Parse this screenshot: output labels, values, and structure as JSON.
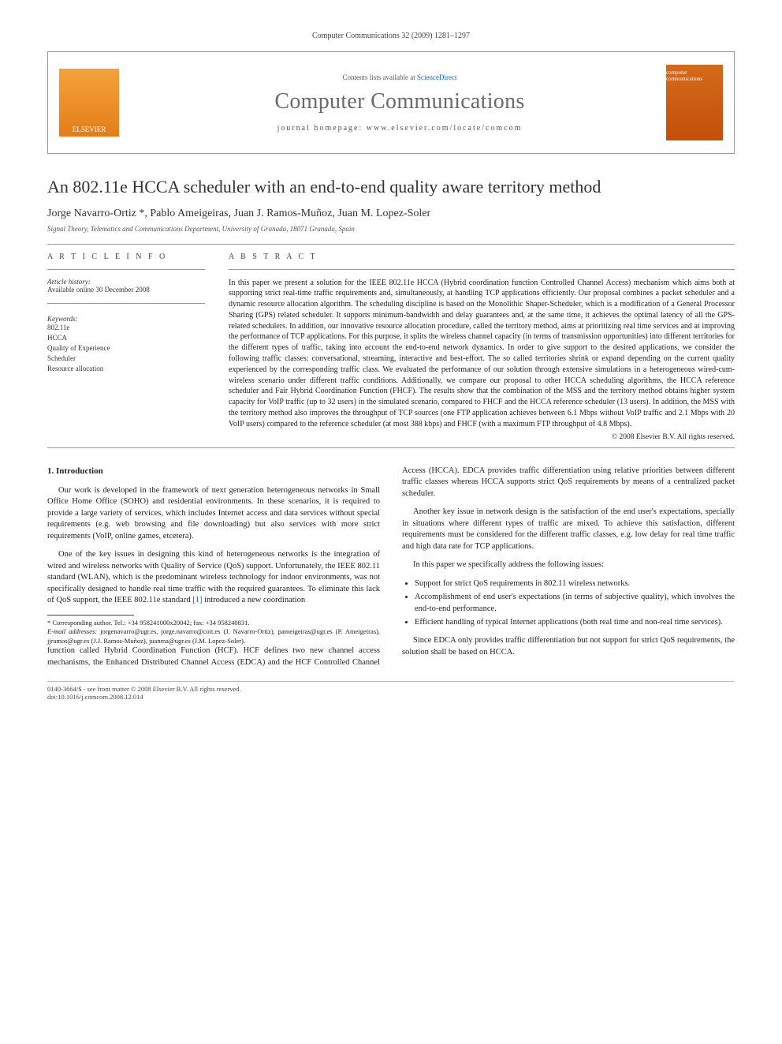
{
  "header_citation": "Computer Communications 32 (2009) 1281–1297",
  "journal_box": {
    "contents_prefix": "Contents lists available at ",
    "contents_link": "ScienceDirect",
    "journal_name": "Computer Communications",
    "homepage_label": "journal homepage: www.elsevier.com/locate/comcom",
    "elsevier_label": "ELSEVIER",
    "cover_label": "computer communications"
  },
  "title": "An 802.11e HCCA scheduler with an end-to-end quality aware territory method",
  "authors": "Jorge Navarro-Ortiz *, Pablo Ameigeiras, Juan J. Ramos-Muñoz, Juan M. Lopez-Soler",
  "affiliation": "Signal Theory, Telematics and Communications Department, University of Granada, 18071 Granada, Spain",
  "article_info": {
    "heading": "A R T I C L E   I N F O",
    "history_label": "Article history:",
    "history_line": "Available online 30 December 2008",
    "keywords_label": "Keywords:",
    "keywords": [
      "802.11e",
      "HCCA",
      "Quality of Experience",
      "Scheduler",
      "Resource allocation"
    ]
  },
  "abstract": {
    "heading": "A B S T R A C T",
    "text": "In this paper we present a solution for the IEEE 802.11e HCCA (Hybrid coordination function Controlled Channel Access) mechanism which aims both at supporting strict real-time traffic requirements and, simultaneously, at handling TCP applications efficiently. Our proposal combines a packet scheduler and a dynamic resource allocation algorithm. The scheduling discipline is based on the Monolithic Shaper-Scheduler, which is a modification of a General Processor Sharing (GPS) related scheduler. It supports minimum-bandwidth and delay guarantees and, at the same time, it achieves the optimal latency of all the GPS-related schedulers. In addition, our innovative resource allocation procedure, called the territory method, aims at prioritizing real time services and at improving the performance of TCP applications. For this purpose, it splits the wireless channel capacity (in terms of transmission opportunities) into different territories for the different types of traffic, taking into account the end-to-end network dynamics. In order to give support to the desired applications, we consider the following traffic classes: conversational, streaming, interactive and best-effort. The so called territories shrink or expand depending on the current quality experienced by the corresponding traffic class. We evaluated the performance of our solution through extensive simulations in a heterogeneous wired-cum-wireless scenario under different traffic conditions. Additionally, we compare our proposal to other HCCA scheduling algorithms, the HCCA reference scheduler and Fair Hybrid Coordination Function (FHCF). The results show that the combination of the MSS and the territory method obtains higher system capacity for VoIP traffic (up to 32 users) in the simulated scenario, compared to FHCF and the HCCA reference scheduler (13 users). In addition, the MSS with the territory method also improves the throughput of TCP sources (one FTP application achieves between 6.1 Mbps without VoIP traffic and 2.1 Mbps with 20 VoIP users) compared to the reference scheduler (at most 388 kbps) and FHCF (with a maximum FTP throughput of 4.8 Mbps).",
    "copyright": "© 2008 Elsevier B.V. All rights reserved."
  },
  "section1": {
    "heading": "1. Introduction",
    "p1": "Our work is developed in the framework of next generation heterogeneous networks in Small Office Home Office (SOHO) and residential environments. In these scenarios, it is required to provide a large variety of services, which includes Internet access and data services without special requirements (e.g. web browsing and file downloading) but also services with more strict requirements (VoIP, online games, etcetera).",
    "p2_a": "One of the key issues in designing this kind of heterogeneous networks is the integration of wired and wireless networks with Quality of Service (QoS) support. Unfortunately, the IEEE 802.11 standard (WLAN), which is the predominant wireless technology for indoor environments, was not specifically designed to handle real time traffic with the required guarantees. To eliminate this lack of QoS support, the IEEE 802.11e standard ",
    "p2_ref": "[1]",
    "p2_b": " introduced a new coordination",
    "p3": "function called Hybrid Coordination Function (HCF). HCF defines two new channel access mechanisms, the Enhanced Distributed Channel Access (EDCA) and the HCF Controlled Channel Access (HCCA). EDCA provides traffic differentiation using relative priorities between different traffic classes whereas HCCA supports strict QoS requirements by means of a centralized packet scheduler.",
    "p4": "Another key issue in network design is the satisfaction of the end user's expectations, specially in situations where different types of traffic are mixed. To achieve this satisfaction, different requirements must be considered for the different traffic classes, e.g. low delay for real time traffic and high data rate for TCP applications.",
    "p5": "In this paper we specifically address the following issues:",
    "bullets": [
      "Support for strict QoS requirements in 802.11 wireless networks.",
      "Accomplishment of end user's expectations (in terms of subjective quality), which involves the end-to-end performance.",
      "Efficient handling of typical Internet applications (both real time and non-real time services)."
    ],
    "p6": "Since EDCA only provides traffic differentiation but not support for strict QoS requirements, the solution shall be based on HCCA."
  },
  "footnotes": {
    "corr": "* Corresponding author. Tel.: +34 958241000x20042; fax: +34 958240831.",
    "email_label": "E-mail addresses:",
    "emails": "jorgenavarro@ugr.es, jorge.navarro@coit.es (J. Navarro-Ortiz), pameigeiras@ugr.es (P. Ameigeiras), jjramos@ugr.es (J.J. Ramos-Muñoz), juanma@ugr.es (J.M. Lopez-Soler)."
  },
  "bottom": {
    "line1": "0140-3664/$ - see front matter © 2008 Elsevier B.V. All rights reserved.",
    "line2": "doi:10.1016/j.comcom.2008.12.014"
  }
}
